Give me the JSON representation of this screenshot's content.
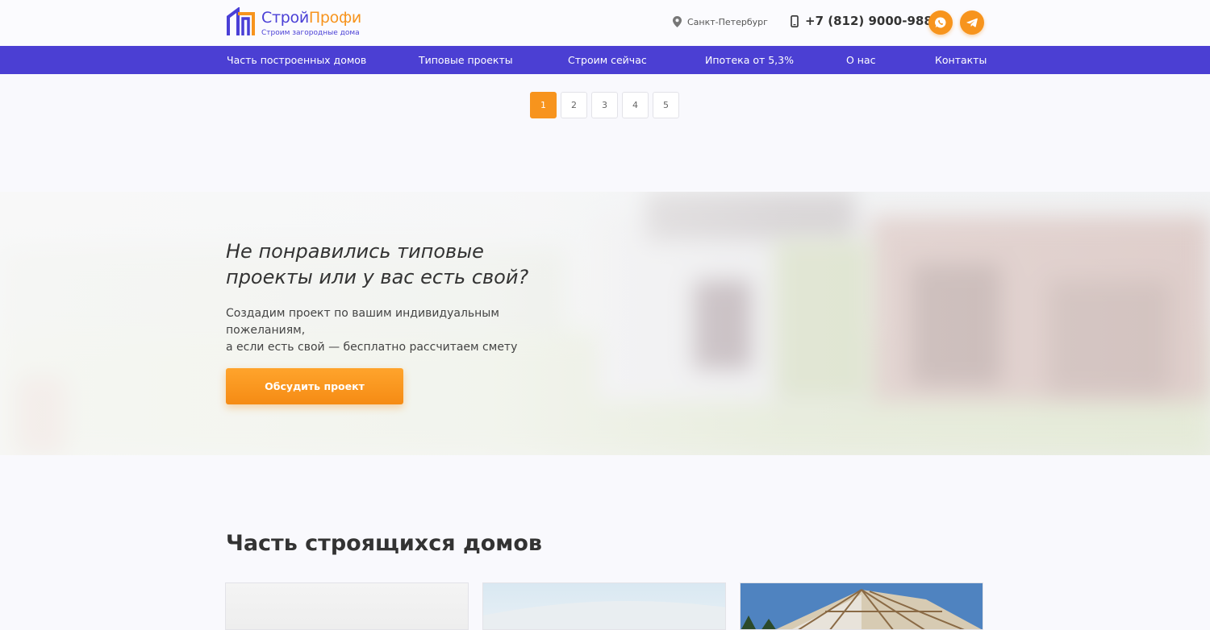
{
  "header": {
    "logo": {
      "name_part1": "Строй",
      "name_part2": "Профи",
      "tagline": "Строим загородные дома"
    },
    "city": "Санкт-Петербург",
    "phone": "+7 (812) 9000-988",
    "social": [
      {
        "icon": "whatsapp-icon"
      },
      {
        "icon": "telegram-icon"
      }
    ]
  },
  "nav": {
    "items": [
      {
        "label": "Часть построенных домов"
      },
      {
        "label": "Типовые проекты"
      },
      {
        "label": "Строим сейчас"
      },
      {
        "label": "Ипотека от 5,3%"
      },
      {
        "label": "О нас"
      },
      {
        "label": "Контакты"
      }
    ]
  },
  "pagination": {
    "pages": [
      "1",
      "2",
      "3",
      "4",
      "5"
    ],
    "active": "1"
  },
  "banner": {
    "title_line1": "Не понравились типовые",
    "title_line2": "проекты или у вас есть свой?",
    "text_line1": "Создадим проект по вашим индивидуальным пожеланиям,",
    "text_line2": "а если есть свой — бесплатно рассчитаем смету",
    "button": "Обсудить проект"
  },
  "section": {
    "title": "Часть строящихся домов"
  },
  "colors": {
    "accent": "#f7941d",
    "brand": "#4b3fd3"
  }
}
